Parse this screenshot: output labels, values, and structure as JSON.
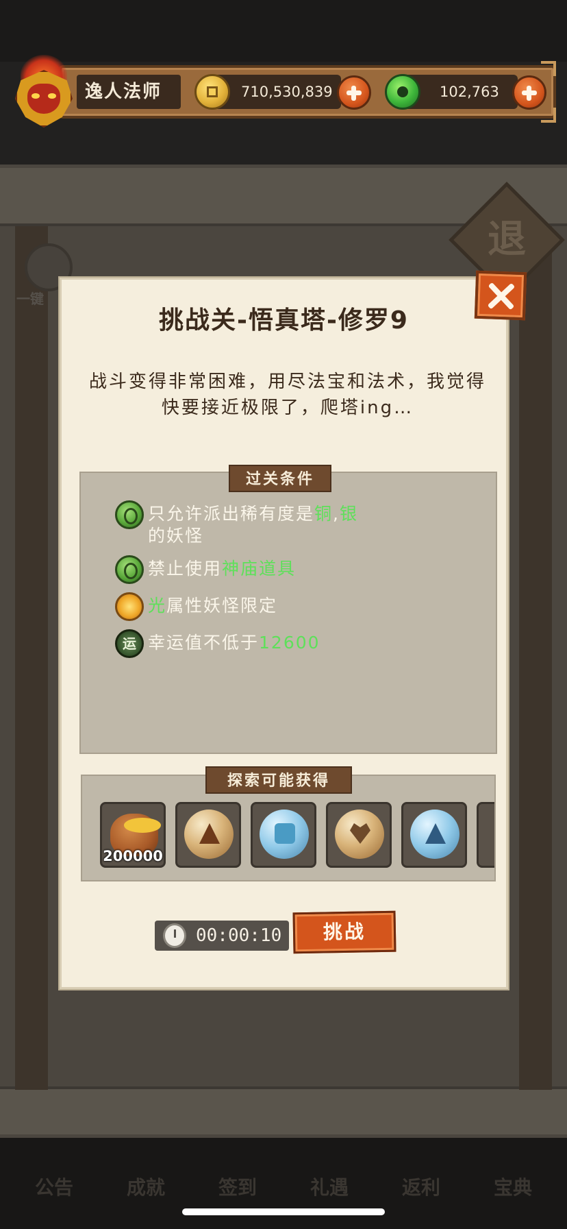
{
  "header": {
    "player_name": "逸人法师",
    "gold_amount": "710,530,839",
    "jade_amount": "102,763"
  },
  "background": {
    "retreat_label": "退",
    "one_key_label": "一键",
    "tabs": [
      "公告",
      "成就",
      "签到",
      "礼遇",
      "返利",
      "宝典"
    ]
  },
  "dialog": {
    "title": "挑战关-悟真塔-修罗9",
    "description": "战斗变得非常困难，用尽法宝和法术，我觉得快要接近极限了，爬塔ing…",
    "conditions_tag": "过关条件",
    "conditions": [
      {
        "icon": "green-gem-icon",
        "pre": "只允许派出稀有度是",
        "hl1": "铜",
        "mid": ",",
        "hl2": "银",
        "post": "的妖怪"
      },
      {
        "icon": "green-gem-icon",
        "pre": "禁止使用",
        "hl1": "神庙道具",
        "mid": "",
        "hl2": "",
        "post": ""
      },
      {
        "icon": "sun-icon",
        "pre": "",
        "hl1": "光",
        "mid": "",
        "hl2": "",
        "post": "属性妖怪限定"
      },
      {
        "icon": "luck-icon",
        "icon_label": "运",
        "pre": "幸运值不低于",
        "hl1": "12600",
        "mid": "",
        "hl2": "",
        "post": ""
      }
    ],
    "rewards_tag": "探索可能获得",
    "rewards": [
      {
        "icon": "gold-bag-icon",
        "qty": "200000"
      },
      {
        "icon": "triangle-rune-orb-icon",
        "qty": ""
      },
      {
        "icon": "puzzle-orb-icon",
        "qty": ""
      },
      {
        "icon": "heart-rune-orb-icon",
        "qty": ""
      },
      {
        "icon": "eye-pyramid-orb-icon",
        "qty": ""
      }
    ],
    "timer": "00:00:10",
    "challenge_label": "挑战"
  },
  "colors": {
    "highlight": "#5ee05a",
    "accent_orange": "#d4551c",
    "parchment": "#f5eedd"
  }
}
